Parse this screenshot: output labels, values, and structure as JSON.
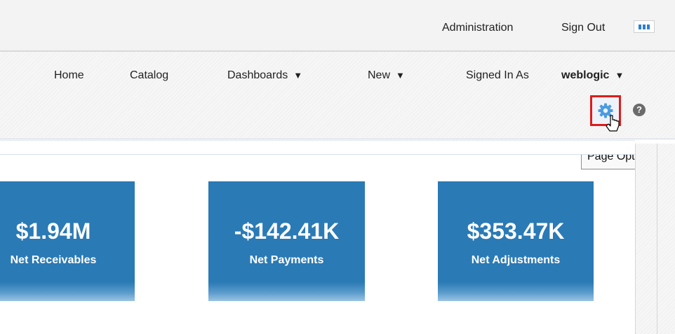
{
  "topbar": {
    "administration": "Administration",
    "sign_out": "Sign Out"
  },
  "nav": {
    "home": "Home",
    "catalog": "Catalog",
    "dashboards": "Dashboards",
    "new": "New",
    "signed_in_as": "Signed In As",
    "username": "weblogic",
    "caret": "▼"
  },
  "icons": {
    "page_options": "gear-icon",
    "help": "help-icon",
    "brand": "app-logo-icon"
  },
  "help_glyph": "?",
  "tooltip": "Page Options",
  "kpis": [
    {
      "value": "$1.94M",
      "label": "Net Receivables"
    },
    {
      "value": "-$142.41K",
      "label": "Net Payments"
    },
    {
      "value": "$353.47K",
      "label": "Net Adjustments"
    }
  ],
  "colors": {
    "tile": "#2a7ab5",
    "highlight": "#e01b1b",
    "gear": "#4c9be0"
  }
}
